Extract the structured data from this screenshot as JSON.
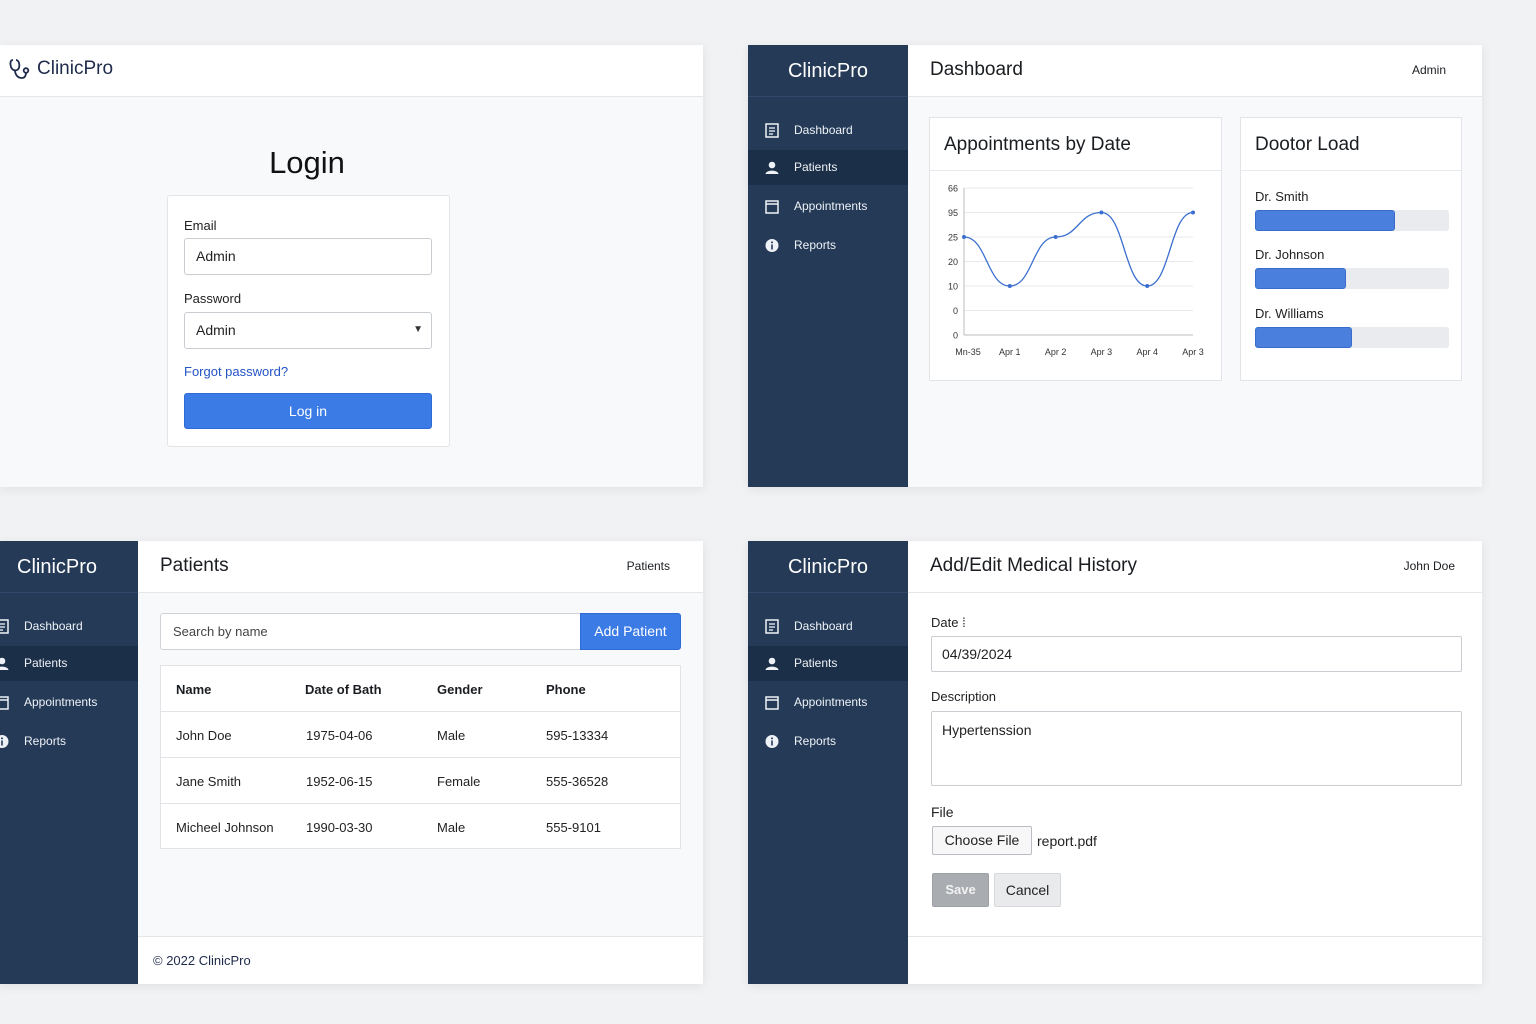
{
  "brand": "ClinicPro",
  "login": {
    "title": "Login",
    "email_label": "Email",
    "email_value": "Admin",
    "password_label": "Password",
    "password_value": "Admin",
    "forgot": "Forgot password?",
    "submit": "Log in"
  },
  "sidebar": {
    "items": [
      {
        "label": "Dashboard",
        "icon": "document-icon"
      },
      {
        "label": "Patients",
        "icon": "user-icon"
      },
      {
        "label": "Appointments",
        "icon": "calendar-icon"
      },
      {
        "label": "Reports",
        "icon": "info-icon"
      }
    ],
    "active": "Patients"
  },
  "dashboard": {
    "title": "Dashboard",
    "user": "Admin",
    "chart_title": "Appointments by Date",
    "load_title": "Dootor Load",
    "doctors": [
      {
        "name": "Dr. Smith",
        "load": 0.72
      },
      {
        "name": "Dr. Johnson",
        "load": 0.47
      },
      {
        "name": "Dr. Williams",
        "load": 0.5
      }
    ]
  },
  "chart_data": {
    "type": "line",
    "title": "Appointments by Date",
    "y_tick_labels": [
      "66",
      "95",
      "25",
      "20",
      "10",
      "0",
      "0"
    ],
    "x_tick_labels": [
      "Mn-35",
      "Apr 1",
      "Apr 2",
      "Apr 3",
      "Apr 4",
      "Apr 3"
    ],
    "series": [
      {
        "points": [
          {
            "x": "Mn-35",
            "y": 25
          },
          {
            "x": "Apr 1",
            "y": 10
          },
          {
            "x": "Apr 2",
            "y": 25
          },
          {
            "x": "Apr 3",
            "y": 95
          },
          {
            "x": "Apr 4",
            "y": 10
          },
          {
            "x": "Apr 3",
            "y": 95
          }
        ]
      }
    ],
    "grid": true,
    "color": "#3b6fd0"
  },
  "patients": {
    "title": "Patients",
    "header_right": "Patients",
    "search_placeholder": "Search by name",
    "add_button": "Add Patient",
    "columns": [
      "Name",
      "Date of Bath",
      "Gender",
      "Phone"
    ],
    "rows": [
      [
        "John Doe",
        "1975-04-06",
        "Male",
        "595-13334"
      ],
      [
        "Jane Smith",
        "1952-06-15",
        "Female",
        "555-36528"
      ],
      [
        "Micheel Johnson",
        "1990-03-30",
        "Male",
        "555-9101"
      ]
    ],
    "footer": "© 2022 ClinicPro"
  },
  "history": {
    "title": "Add/Edit Medical History",
    "user": "John Doe",
    "date_label": "Date",
    "date_mark": "⁞",
    "date_value": "04/39/2024",
    "description_label": "Description",
    "description_value": "Hypertenssion",
    "file_label": "File",
    "choose_file": "Choose File",
    "file_name": "report.pdf",
    "save": "Save",
    "cancel": "Cancel"
  }
}
